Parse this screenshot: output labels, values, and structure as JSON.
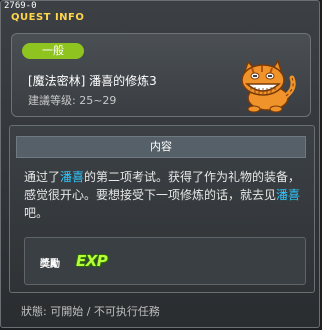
{
  "window": {
    "quest_id": "2769-0",
    "title": "QUEST INFO"
  },
  "quest": {
    "category": "一般",
    "name": "[魔法密林] 潘喜的修炼3",
    "level": "建議等级: 25~29"
  },
  "content": {
    "header": "内容",
    "text_1": "通过了",
    "npc_1": "潘喜",
    "text_2": "的第二项考试。获得了作为礼物的装备，感觉很开心。要想接受下一项修炼的话，就去见",
    "npc_2": "潘喜",
    "text_3": "吧。"
  },
  "reward": {
    "label": "奬勵",
    "exp_icon_text": "EXP"
  },
  "status_line": "狀態: 可開始 / 不可执行任務",
  "colors": {
    "title": "#ffd54a",
    "badge": "#8fc31f",
    "npc_highlight": "#2ec9ff",
    "cat_orange": "#f0932b"
  },
  "icons": {
    "npc": "orange-tabby-cat-icon",
    "reward": "exp-icon"
  }
}
